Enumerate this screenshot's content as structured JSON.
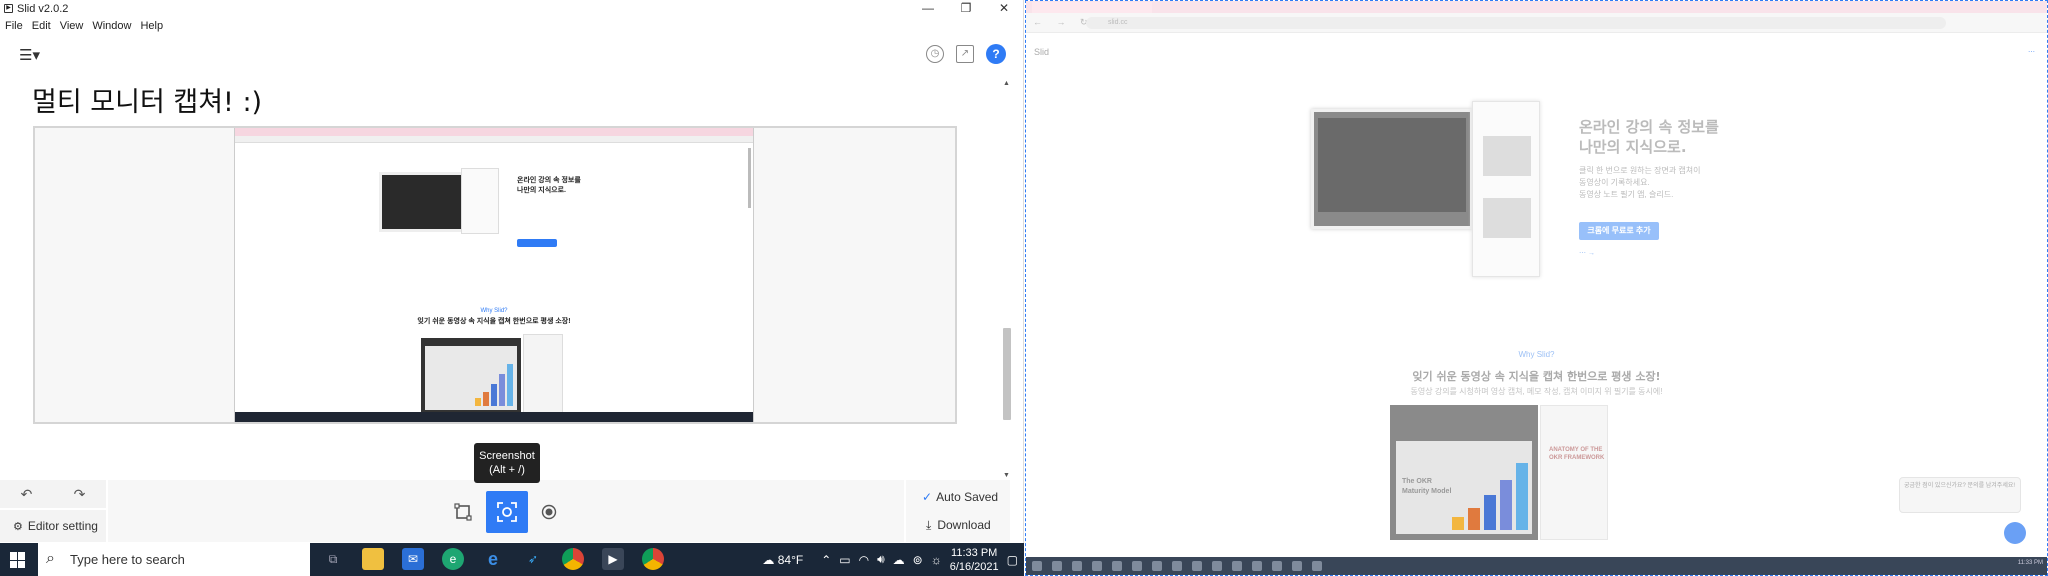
{
  "app": {
    "title": "Slid v2.0.2",
    "menu": [
      "File",
      "Edit",
      "View",
      "Window",
      "Help"
    ],
    "window_buttons": {
      "minimize": "—",
      "maximize": "❐",
      "close": "✕"
    },
    "help_label": "?"
  },
  "editor": {
    "heading": "멀티 모니터 캡쳐! :)",
    "capture_preview": {
      "hero_title_line1": "온라인 강의 속 정보를",
      "hero_title_line2": "나만의 지식으로.",
      "why_label": "Why Slid?",
      "why_title": "잊기 쉬운 동영상 속 지식을 캡쳐 한번으로 평생 소장!"
    }
  },
  "tooltip": {
    "line1": "Screenshot",
    "line2": "(Alt + /)"
  },
  "bottom_bar": {
    "editor_setting": "Editor setting",
    "auto_saved": "Auto Saved",
    "download": "Download"
  },
  "taskbar": {
    "search_placeholder": "Type here to search",
    "weather": "84°F",
    "time": "11:33 PM",
    "date": "6/16/2021"
  },
  "browser": {
    "url": "slid.cc",
    "logo": "Slid",
    "hero_title_line1": "온라인 강의 속 정보를",
    "hero_title_line2": "나만의 지식으로.",
    "hero_desc_line1": "클릭 한 번으로 원하는 장면과 캡쳐이",
    "hero_desc_line2": "동영상이 기록하세요.",
    "hero_desc_line3": "동영상 노트 필기 앱, 슬리드.",
    "hero_button": "크롬에 무료로 추가",
    "why_label": "Why Slid?",
    "why_title": "잊기 쉬운 동영상 속 지식을 캡쳐 한번으로 평생 소장!",
    "why_desc": "동영상 강의를 시청하며 영상 캡쳐, 메모 작성, 캡쳐 이미지 위 필기를 동시에!",
    "demo_title_line1": "The OKR",
    "demo_title_line2": "Maturity Model",
    "demo_side_title": "ANATOMY OF THE OKR FRAMEWORK",
    "chat_text": "궁금한 점이 있으신가요? 문의를 남겨주세요!",
    "clock": "11:33 PM"
  },
  "colors": {
    "accent": "#2f7bf5",
    "taskbar": "#1a2738",
    "bar_colors": [
      "#f3b63f",
      "#e07a3e",
      "#4a78d6",
      "#7a8ddb",
      "#66b3e8"
    ]
  },
  "chart_bars": {
    "values": [
      0.18,
      0.32,
      0.5,
      0.72,
      0.95
    ]
  }
}
